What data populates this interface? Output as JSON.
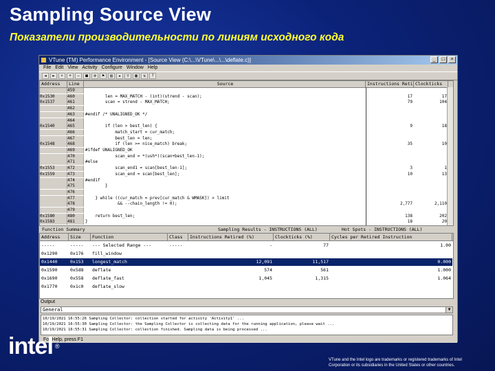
{
  "slide": {
    "title": "Sampling Source View",
    "subtitle": "Показатели производительности по линиям исходного кода",
    "logo_text": "intel",
    "logo_mark": "®",
    "trademark_line1": "VTune and the Intel logo are trademarks or registered trademarks of Intel",
    "trademark_line2": "Corporation or its subsidiaries in the United States or other countries."
  },
  "window": {
    "title": "VTune (TM) Performance Environment - [Source View (C:\\...\\VTune\\...\\...\\deflate.c)]",
    "controls": [
      "_",
      "□",
      "×"
    ],
    "menu": [
      "File",
      "Edit",
      "View",
      "Activity",
      "Configure",
      "Window",
      "Help"
    ]
  },
  "toolbar": {
    "icons": [
      "back-icon",
      "forward-icon",
      "find-icon",
      "zoom-in-icon",
      "zoom-out-icon",
      "stop-icon",
      "settings-icon",
      "bookmark-icon",
      "chart-icon",
      "hotspot-icon",
      "filter-icon",
      "table-icon",
      "sort-icon",
      "help-icon"
    ]
  },
  "source_view": {
    "headers": {
      "address": "Address",
      "line": "Line",
      "source": "Source",
      "instructions": "Instructions Retired",
      "clockticks": "Clockticks"
    },
    "rows": [
      {
        "addr": "",
        "line": "459",
        "code": "",
        "inst": "",
        "clk": ""
      },
      {
        "addr": "0x1530",
        "line": "460",
        "code": "        len = MAX_MATCH - (int)(strend - scan);",
        "inst": "17",
        "clk": "17"
      },
      {
        "addr": "0x1537",
        "line": "461",
        "code": "        scan = strend - MAX_MATCH;",
        "inst": "79",
        "clk": "104"
      },
      {
        "addr": "",
        "line": "462",
        "code": "",
        "inst": "",
        "clk": ""
      },
      {
        "addr": "",
        "line": "463",
        "code": "#endif /* UNALIGNED_OK */",
        "inst": "",
        "clk": ""
      },
      {
        "addr": "",
        "line": "464",
        "code": "",
        "inst": "",
        "clk": ""
      },
      {
        "addr": "0x1540",
        "line": "465",
        "code": "        if (len > best_len) {",
        "inst": "9",
        "clk": "18"
      },
      {
        "addr": "",
        "line": "466",
        "code": "            match_start = cur_match;",
        "inst": "",
        "clk": ""
      },
      {
        "addr": "",
        "line": "467",
        "code": "            best_len = len;",
        "inst": "",
        "clk": ""
      },
      {
        "addr": "0x1548",
        "line": "468",
        "code": "            if (len >= nice_match) break;",
        "inst": "35",
        "clk": "10"
      },
      {
        "addr": "",
        "line": "469",
        "code": "#ifdef UNALIGNED_OK",
        "inst": "",
        "clk": ""
      },
      {
        "addr": "",
        "line": "470",
        "code": "            scan_end = *(ush*)(scan+best_len-1);",
        "inst": "",
        "clk": ""
      },
      {
        "addr": "",
        "line": "471",
        "code": "#else",
        "inst": "",
        "clk": ""
      },
      {
        "addr": "0x1553",
        "line": "472",
        "code": "            scan_end1 = scan[best_len-1];",
        "inst": "3",
        "clk": "1"
      },
      {
        "addr": "0x1559",
        "line": "473",
        "code": "            scan_end = scan[best_len];",
        "inst": "10",
        "clk": "13"
      },
      {
        "addr": "",
        "line": "474",
        "code": "#endif",
        "inst": "",
        "clk": ""
      },
      {
        "addr": "",
        "line": "475",
        "code": "        }",
        "inst": "",
        "clk": ""
      },
      {
        "addr": "",
        "line": "476",
        "code": "",
        "inst": "",
        "clk": ""
      },
      {
        "addr": "",
        "line": "477",
        "code": "    } while ((cur_match = prev[cur_match & WMASK]) > limit",
        "inst": "",
        "clk": ""
      },
      {
        "addr": "",
        "line": "478",
        "code": "             && --chain_length != 0);",
        "inst": "2,777",
        "clk": "2,110"
      },
      {
        "addr": "",
        "line": "479",
        "code": "",
        "inst": "",
        "clk": ""
      },
      {
        "addr": "0x1580",
        "line": "480",
        "code": "    return best_len;",
        "inst": "138",
        "clk": "202"
      },
      {
        "addr": "0x1583",
        "line": "481",
        "code": "}",
        "inst": "18",
        "clk": "20"
      }
    ]
  },
  "function_tabs": {
    "left": "Function Summary",
    "middle": "Sampling Results - INSTRUCTIONS (ALL)",
    "right": "Hot Spots - INSTRUCTIONS (ALL)"
  },
  "function_grid": {
    "headers": {
      "address": "Address",
      "size": "Size",
      "function": "Function",
      "class": "Class",
      "inst": "Instructions Retired (%)",
      "clk": "Clockticks (%)",
      "cpi": "Cycles per Retired Instruction"
    },
    "rows": [
      {
        "addr": "-----",
        "size": "-----",
        "func": "--- Selected Range ---",
        "cls": "-----",
        "inst": "-",
        "clk": "77",
        "cpi": "1.00",
        "selected": false
      },
      {
        "addr": "0x1290",
        "size": "0x176",
        "func": "fill_window",
        "cls": "",
        "inst": "",
        "clk": "",
        "cpi": "",
        "selected": false
      },
      {
        "addr": "0x1440",
        "size": "0x153",
        "func": "longest_match",
        "cls": "",
        "inst": "12,091",
        "clk": "11,517",
        "cpi": "0.000",
        "selected": true
      },
      {
        "addr": "0x1590",
        "size": "0x5d8",
        "func": "deflate",
        "cls": "",
        "inst": "574",
        "clk": "561",
        "cpi": "1.000",
        "selected": false
      },
      {
        "addr": "0x1690",
        "size": "0x558",
        "func": "deflate_fast",
        "cls": "",
        "inst": "1,045",
        "clk": "1,315",
        "cpi": "1.064",
        "selected": false
      },
      {
        "addr": "0x1770",
        "size": "0x1c0",
        "func": "deflate_slow",
        "cls": "",
        "inst": "",
        "clk": "",
        "cpi": "",
        "selected": false
      }
    ]
  },
  "output": {
    "title": "Output",
    "selected": "General",
    "lines": [
      "10/19/2021 16:55:26  Sampling Collector: collection started for activity 'Activity1' ...",
      "10/19/2021 16:55:30  Sampling Collector: the Sampling Collector is collecting data for the running application, please wait ...",
      "10/19/2021 16:55:31  Sampling Collector: collection finished. Sampling data is being processed ..."
    ],
    "status": "For Help, press F1"
  }
}
